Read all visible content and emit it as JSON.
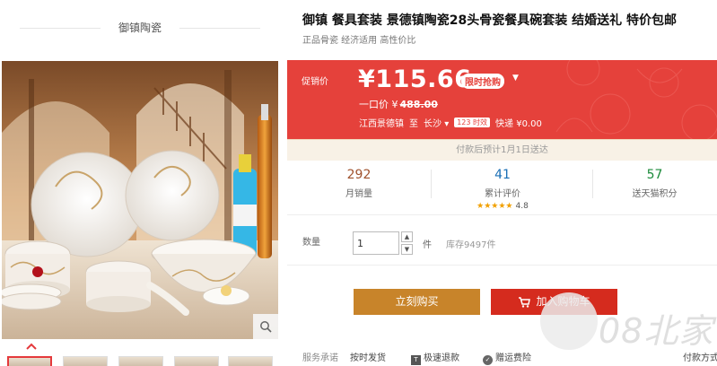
{
  "brand": "御镇陶瓷",
  "product": {
    "title": "御镇 餐具套装 景德镇陶瓷28头骨瓷餐具碗套装 结婚送礼 特价包邮",
    "subtitle": "正品骨瓷 经济适用 高性价比"
  },
  "price": {
    "label": "促销价",
    "current": "¥115.66",
    "badge": "限时抢购",
    "original_prefix": "一口价 ¥",
    "original": "488.00",
    "ship_from": "江西景德镇",
    "ship_to_prefix": "至",
    "ship_to": "长沙",
    "time_badge": "123 时效",
    "shipping_fee": "快递 ¥0.00"
  },
  "notice": "付款后预计1月1日送达",
  "stats": {
    "monthly_sales": "292",
    "monthly_sales_label": "月销量",
    "reviews": "41",
    "reviews_label": "累计评价",
    "rating": "4.8",
    "rating_stars": 5,
    "points": "57",
    "points_label": "送天猫积分"
  },
  "quantity": {
    "label": "数量",
    "value": "1",
    "unit": "件",
    "stock": "库存9497件"
  },
  "actions": {
    "buy_now": "立刻购买",
    "add_to_cart": "加入购物车"
  },
  "services": {
    "label": "服务承诺",
    "items": [
      "按时发货",
      "极速退款",
      "赠运费险",
      "付款方式"
    ]
  },
  "watermark": "08北家",
  "colors": {
    "price_bg": "#e5413b",
    "buy_button": "#c8842a",
    "cart_button": "#d52b1e",
    "sales_number": "#a0522d",
    "reviews_number": "#1a6fb5",
    "points_number": "#1b8a3a",
    "rating_stars": "#f1a000"
  },
  "icons": [
    "search-icon",
    "chevron-up-icon",
    "chevron-down-icon",
    "cart-icon",
    "refund-icon",
    "insurance-icon"
  ]
}
